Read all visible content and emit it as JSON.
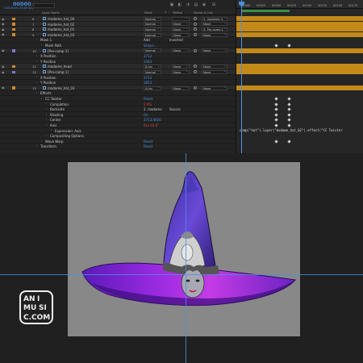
{
  "toolbar": {
    "timecode": "00000",
    "fps": "0:00:00:00 (25.00 fps)"
  },
  "columns": {
    "layer_name": "Layer Name",
    "mode": "Mode",
    "t": "T",
    "trkmat": "TrkMat",
    "parent": "Parent & Link"
  },
  "ruler": [
    "00000",
    "00025",
    "00050",
    "00075",
    "00100",
    "00125",
    "00150",
    "00175"
  ],
  "rows": [
    {
      "kind": "layer",
      "num": "6",
      "name": "madame_hat_04",
      "mode": "Normal",
      "trk": "",
      "parent": "2. madame_h",
      "color": "#d08a2a"
    },
    {
      "kind": "layer",
      "num": "7",
      "name": "madame_hat_02",
      "mode": "Normal",
      "trk": "None",
      "parent": "None",
      "color": "#d08a2a"
    },
    {
      "kind": "layer",
      "num": "8",
      "name": "madame_hat_01",
      "mode": "Normal",
      "trk": "None",
      "parent": "3. Pre-comp 1",
      "color": "#d08a2a"
    },
    {
      "kind": "layer",
      "num": "9",
      "name": "madame_hat_03",
      "mode": "Normal",
      "trk": "None",
      "parent": "None",
      "color": "#d08a2a"
    },
    {
      "kind": "prop",
      "name": "Mask 1",
      "indent": 1,
      "val": "Add",
      "val2": "Inverted",
      "valclass": "white"
    },
    {
      "kind": "prop",
      "name": "Mask Path",
      "indent": 2,
      "val": "Shape...",
      "valclass": ""
    },
    {
      "kind": "layer",
      "num": "10",
      "name": "[Pre-comp 1]",
      "mode": "Normal",
      "trk": "None",
      "parent": "None",
      "color": "#7a7ac8"
    },
    {
      "kind": "prop",
      "name": "X Position",
      "indent": 1,
      "val": "3713",
      "valclass": ""
    },
    {
      "kind": "prop",
      "name": "Y Position",
      "indent": 1,
      "val": "2463",
      "valclass": ""
    },
    {
      "kind": "layer",
      "num": "11",
      "name": "madame_head",
      "mode": "A.Inv",
      "trk": "None",
      "parent": "None",
      "color": "#d08a2a"
    },
    {
      "kind": "layer",
      "num": "12",
      "name": "[Pre-comp 1]",
      "mode": "Normal",
      "trk": "None",
      "parent": "None",
      "color": "#7a7ac8"
    },
    {
      "kind": "prop",
      "name": "X Position",
      "indent": 1,
      "val": "3713",
      "valclass": ""
    },
    {
      "kind": "prop",
      "name": "Y Position",
      "indent": 1,
      "val": "3853",
      "valclass": ""
    },
    {
      "kind": "layer",
      "num": "13",
      "name": "madame_hat_03",
      "mode": "A.Inv",
      "trk": "None",
      "parent": "None",
      "color": "#d08a2a"
    },
    {
      "kind": "prop",
      "name": "Effects",
      "indent": 1,
      "val": "",
      "valclass": ""
    },
    {
      "kind": "prop",
      "name": "CC Twister",
      "indent": 2,
      "val": "Reset",
      "valclass": ""
    },
    {
      "kind": "prop",
      "name": "Completion",
      "indent": 3,
      "val": "2.0%",
      "valclass": "red"
    },
    {
      "kind": "prop",
      "name": "Backside",
      "indent": 3,
      "val": "2. madame",
      "val2": "Source",
      "valclass": "white"
    },
    {
      "kind": "prop",
      "name": "Shading",
      "indent": 3,
      "val": "On",
      "valclass": ""
    },
    {
      "kind": "prop",
      "name": "Center",
      "indent": 3,
      "val": "3713,4016",
      "valclass": ""
    },
    {
      "kind": "prop",
      "name": "Axis",
      "indent": 3,
      "val": "0x+10.0°",
      "valclass": "red"
    },
    {
      "kind": "prop",
      "name": "Expression: Axis",
      "indent": 4,
      "val": "",
      "valclass": ""
    },
    {
      "kind": "prop",
      "name": "Compositing Options",
      "indent": 3,
      "val": "",
      "valclass": ""
    },
    {
      "kind": "prop",
      "name": "Wave Warp",
      "indent": 2,
      "val": "Reset",
      "valclass": ""
    },
    {
      "kind": "prop",
      "name": "Transform",
      "indent": 1,
      "val": "Reset",
      "valclass": ""
    }
  ],
  "expression": "comp(\"hat\").layer(\"madame_hat_02\").effect(\"CC Twister",
  "logo": {
    "text": "ANIMUSIC.COM"
  },
  "colors": {
    "accent": "#4a90e2",
    "label_orange": "#d08a2a",
    "bar_orange": "#c38a18",
    "comp_bg": "#888888",
    "hat_purple": "#6a2ac8"
  }
}
